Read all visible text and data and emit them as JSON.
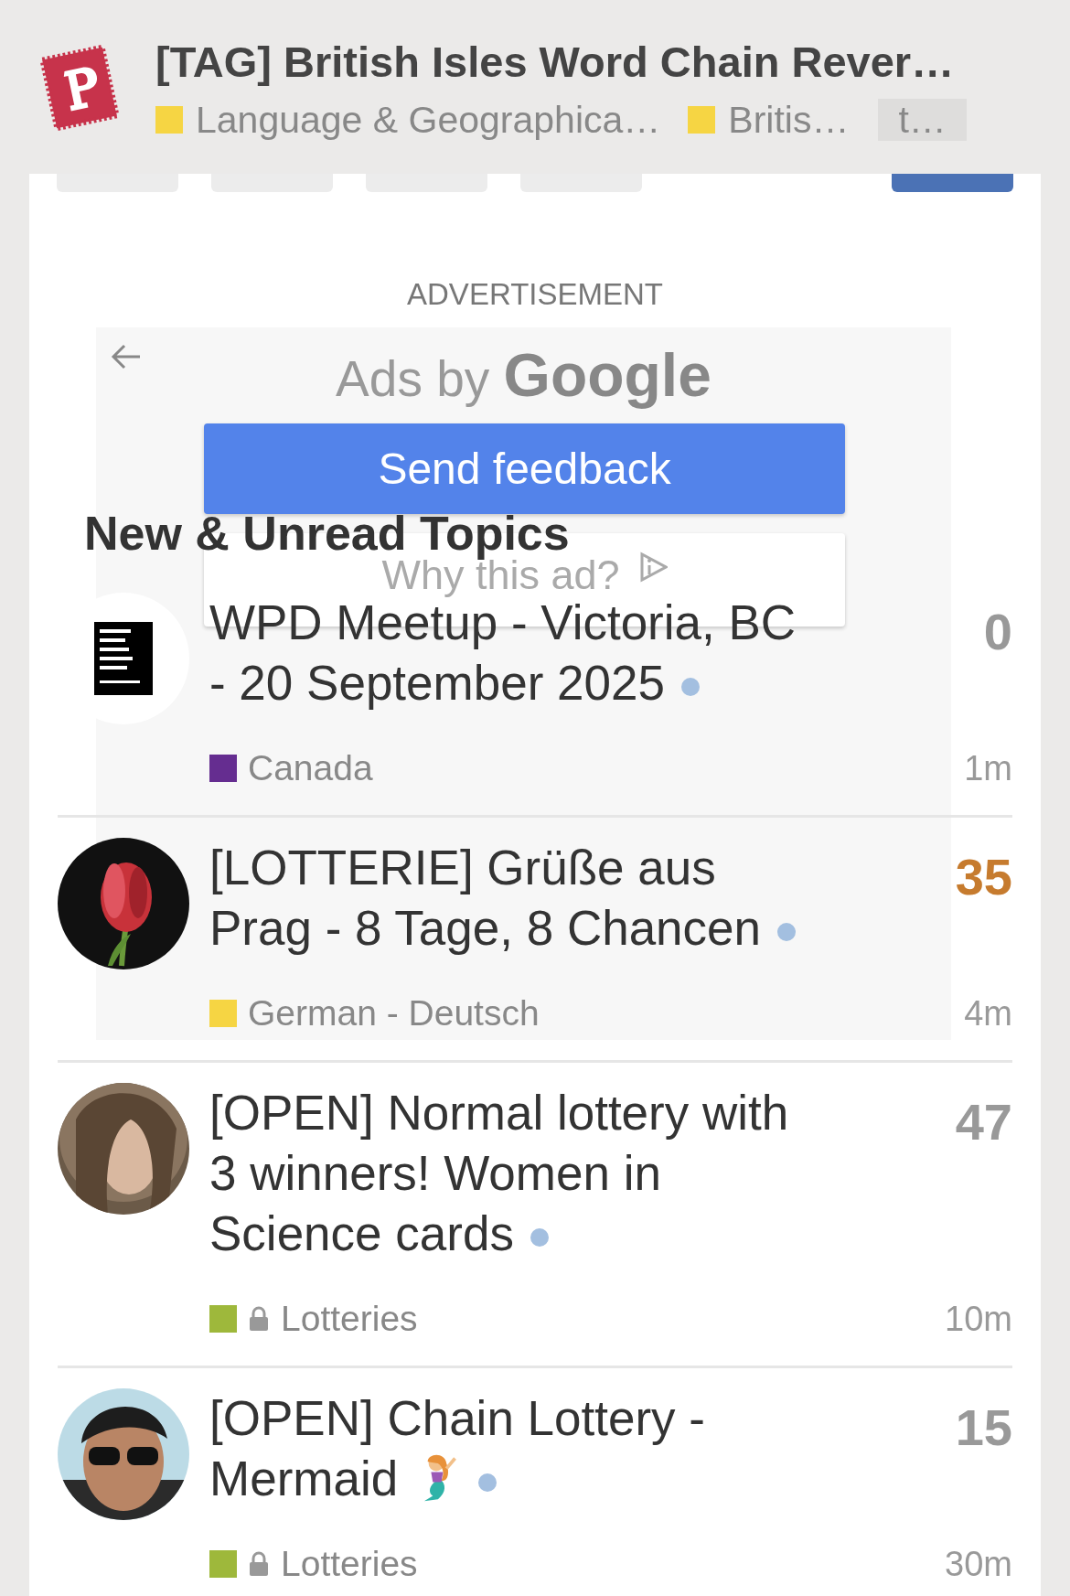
{
  "header": {
    "title": "[TAG] British Isles Word Chain Rever…",
    "tags": [
      {
        "label": "Language & Geographica…",
        "color": "#f6d543",
        "kind": "category"
      },
      {
        "label": "Britis…",
        "color": "#f6d543",
        "kind": "category"
      },
      {
        "label": "t…",
        "kind": "tag"
      }
    ]
  },
  "ad": {
    "caption": "ADVERTISEMENT",
    "label": "Ads by",
    "brand": "Google",
    "feedback": "Send feedback",
    "why": "Why this ad?"
  },
  "heading": "New & Unread Topics",
  "topics": [
    {
      "kind": "plain",
      "title": "WPD Meetup - Victoria, BC - 20 September 2025",
      "unread": true,
      "count": "0",
      "hot": false,
      "category": "Canada",
      "color": "#652d90",
      "locked": false,
      "time": "1m"
    },
    {
      "kind": "plain",
      "title": "[LOTTERIE] Grüße aus Prag - 8 Tage, 8 Chancen",
      "unread": true,
      "count": "35",
      "hot": true,
      "category": "German - Deutsch",
      "color": "#f6d543",
      "locked": false,
      "time": "4m"
    },
    {
      "kind": "plain",
      "title": "[OPEN] Normal lottery with 3 winners! Women in Science cards",
      "unread": true,
      "count": "47",
      "hot": false,
      "category": "Lotteries",
      "color": "#9eb83b",
      "locked": true,
      "time": "10m"
    },
    {
      "kind": "emoji",
      "title": "[OPEN] Chain Lottery - Mermaid",
      "unread": true,
      "count": "15",
      "hot": false,
      "category": "Lotteries",
      "color": "#9eb83b",
      "locked": true,
      "time": "30m"
    }
  ]
}
